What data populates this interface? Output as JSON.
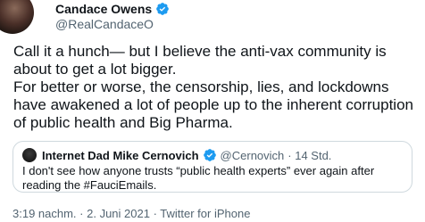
{
  "tweet": {
    "author": {
      "display_name": "Candace Owens",
      "handle": "@RealCandaceO",
      "verified": true
    },
    "text_lines": [
      "Call it a hunch— but I believe the anti-vax community is about to get a lot bigger.",
      "For better or worse, the censorship, lies, and lockdowns have awakened a lot of people up to the inherent corruption of public health and Big Pharma."
    ],
    "quoted": {
      "display_name": "Internet Dad Mike Cernovich",
      "handle": "@Cernovich",
      "time": "· 14 Std.",
      "text": "I don't see how anyone trusts “public health experts” ever again after reading the #FauciEmails."
    },
    "footer": {
      "time": "3:19 nachm.",
      "date": "· 2. Juni 2021",
      "client": "· Twitter for iPhone"
    }
  },
  "colors": {
    "verified_blue": "#1d9bf0",
    "secondary_text": "#536471",
    "border": "#cfd9de"
  },
  "icons": {
    "verified": "verified-badge-icon",
    "more": "more-options-icon"
  }
}
